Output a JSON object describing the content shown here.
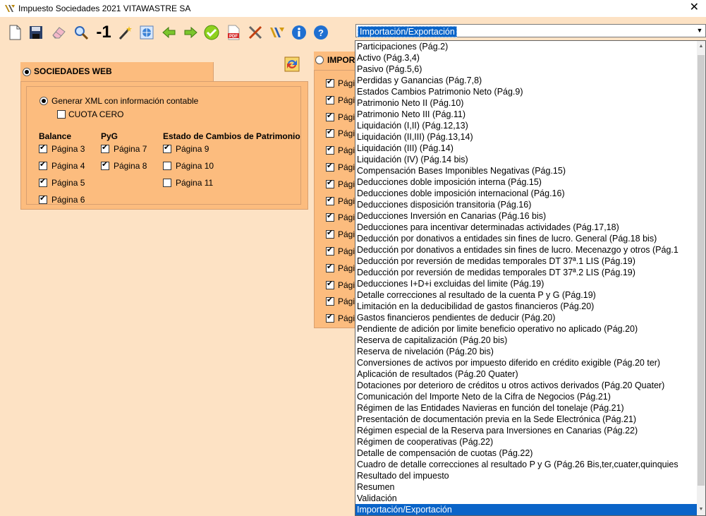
{
  "window": {
    "title": "Impuesto Sociedades 2021 VITAWASTRE SA",
    "close_symbol": "✕"
  },
  "toolbar": {
    "buttons": [
      {
        "name": "new-icon"
      },
      {
        "name": "save-icon"
      },
      {
        "name": "eraser-icon"
      },
      {
        "name": "search-icon"
      },
      {
        "name": "minus-one-icon",
        "label": "-1"
      },
      {
        "name": "magic-wand-icon"
      },
      {
        "name": "web-icon"
      },
      {
        "name": "arrow-left-icon"
      },
      {
        "name": "arrow-right-icon"
      },
      {
        "name": "check-icon"
      },
      {
        "name": "pdf-icon"
      },
      {
        "name": "tools-icon"
      },
      {
        "name": "sign-icon"
      },
      {
        "name": "info-icon"
      },
      {
        "name": "help-icon"
      }
    ]
  },
  "combo": {
    "selected": "Importación/Exportación",
    "options": [
      "Participaciones (Pág.2)",
      "Activo (Pág.3,4)",
      "Pasivo (Pág.5,6)",
      "Perdidas y Ganancias (Pág.7,8)",
      "Estados Cambios Patrimonio Neto (Pág.9)",
      "Patrimonio Neto II (Pág.10)",
      "Patrimonio Neto III (Pág.11)",
      "Liquidación (I,II) (Pág.12,13)",
      "Liquidación (II,III) (Pág.13,14)",
      "Liquidación (III) (Pág.14)",
      "Liquidación (IV) (Pág.14 bis)",
      "Compensación Bases Imponibles Negativas (Pág.15)",
      "Deducciones doble imposición interna (Pág.15)",
      "Deducciones doble imposición internacional (Pág.16)",
      "Deducciones disposición transitoria (Pág.16)",
      "Deducciones Inversión en Canarias (Pág.16 bis)",
      "Deducciones para incentivar determinadas actividades (Pág.17,18)",
      "Deducción por donativos a entidades sin fines de lucro. General (Pág.18 bis)",
      "Deducción por donativos a entidades sin fines de lucro. Mecenazgo y otros (Pág.1",
      "Deducción por reversión de medidas temporales DT 37ª.1 LIS (Pág.19)",
      "Deducción por reversión de medidas temporales DT 37ª.2 LIS (Pág.19)",
      "Deducciones I+D+i excluidas del limite (Pág.19)",
      "Detalle correcciones al resultado de la cuenta P y G (Pág.19)",
      "Limitación en la deducibilidad de gastos financieros (Pág.20)",
      "Gastos financieros pendientes de deducir (Pág.20)",
      "Pendiente de adición por limite beneficio operativo no aplicado (Pág.20)",
      "Reserva de capitalización (Pág.20 bis)",
      "Reserva de nivelación (Pág.20 bis)",
      "Conversiones de activos por impuesto diferido en crédito exigible (Pág.20 ter)",
      "Aplicación de resultados (Pág.20 Quater)",
      "Dotaciones por deterioro de créditos u otros activos derivados (Pág.20 Quater)",
      "Comunicación del Importe Neto de la Cifra de Negocios (Pág.21)",
      "Régimen de las Entidades Navieras en función del tonelaje (Pág.21)",
      "Presentación de documentación previa en la Sede Electrónica (Pág.21)",
      "Régimen especial de la Reserva para Inversiones en Canarias (Pág.22)",
      "Régimen de cooperativas (Pág.22)",
      "Detalle de compensación de cuotas (Pág.22)",
      "Cuadro de detalle correcciones al resultado P y G (Pág.26 Bis,ter,cuater,quinquies",
      "Resultado del impuesto",
      "Resumen",
      "Validación",
      "Importación/Exportación"
    ],
    "selected_index": 41
  },
  "left_tab": {
    "label": "SOCIEDADES WEB",
    "generar_xml": "Generar XML con información contable",
    "cuota_cero": "CUOTA CERO",
    "groups": {
      "balance": {
        "heading": "Balance",
        "pages": [
          {
            "label": "Página 3",
            "checked": true
          },
          {
            "label": "Página 4",
            "checked": true
          },
          {
            "label": "Página 5",
            "checked": true
          },
          {
            "label": "Página 6",
            "checked": true
          }
        ]
      },
      "pyg": {
        "heading": "PyG",
        "pages": [
          {
            "label": "Página 7",
            "checked": true
          },
          {
            "label": "Página 8",
            "checked": true
          }
        ]
      },
      "ecpn": {
        "heading": "Estado de Cambios de Patrimonio",
        "pages": [
          {
            "label": "Página 9",
            "checked": true
          },
          {
            "label": "Página 10",
            "checked": false
          },
          {
            "label": "Página 11",
            "checked": false
          }
        ]
      }
    }
  },
  "right_tab": {
    "label": "IMPOR",
    "item_label": "Pági",
    "items_checked": [
      true,
      true,
      true,
      true,
      true,
      true,
      true,
      true,
      true,
      true,
      true,
      true,
      true,
      true,
      true
    ]
  }
}
